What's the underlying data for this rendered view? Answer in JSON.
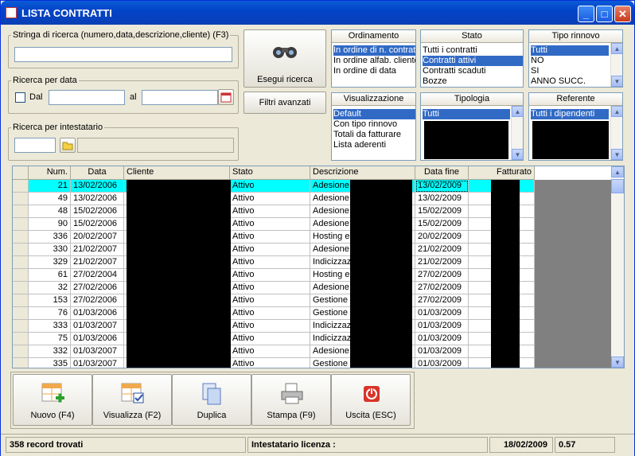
{
  "window": {
    "title": "LISTA CONTRATTI"
  },
  "search": {
    "label": "Stringa di ricerca (numero,data,descrizione,cliente) (F3)",
    "value": ""
  },
  "date_search": {
    "label": "Ricerca per data",
    "dal": "Dal",
    "al": "al"
  },
  "owner_search": {
    "label": "Ricerca per intestatario"
  },
  "buttons": {
    "search": "Esegui ricerca",
    "filters": "Filtri avanzati"
  },
  "ordinamento": {
    "title": "Ordinamento",
    "items": [
      "In ordine di n. contratto",
      "In ordine alfab. cliente",
      "In ordine di data"
    ],
    "selected": 0
  },
  "stato": {
    "title": "Stato",
    "items": [
      "Tutti i contratti",
      "Contratti attivi",
      "Contratti scaduti",
      "Bozze"
    ],
    "selected": 1
  },
  "tipo_rinnovo": {
    "title": "Tipo rinnovo",
    "items": [
      "Tutti",
      "NO",
      "SI",
      "ANNO SUCC."
    ],
    "selected": 0
  },
  "visualizzazione": {
    "title": "Visualizzazione",
    "items": [
      "Default",
      "Con tipo rinnovo",
      "Totali da fatturare",
      "Lista aderenti"
    ],
    "selected": 0
  },
  "tipologia": {
    "title": "Tipologia",
    "items": [
      "Tutti"
    ],
    "selected": 0
  },
  "referente": {
    "title": "Referente",
    "items": [
      "Tutti i dipendenti"
    ],
    "selected": 0
  },
  "grid": {
    "columns": [
      "Num.",
      "Data",
      "Cliente",
      "Stato",
      "Descrizione",
      "Data fine",
      "Fatturato"
    ],
    "rows": [
      {
        "num": "21",
        "data": "13/02/2006",
        "stato": "Attivo",
        "desc": "Adesione",
        "fine": "13/02/2009"
      },
      {
        "num": "49",
        "data": "13/02/2006",
        "stato": "Attivo",
        "desc": "Adesione",
        "fine": "13/02/2009"
      },
      {
        "num": "48",
        "data": "15/02/2006",
        "stato": "Attivo",
        "desc": "Adesione",
        "fine": "15/02/2009"
      },
      {
        "num": "90",
        "data": "15/02/2006",
        "stato": "Attivo",
        "desc": "Adesione",
        "fine": "15/02/2009"
      },
      {
        "num": "336",
        "data": "20/02/2007",
        "stato": "Attivo",
        "desc": "Hosting e",
        "fine": "20/02/2009"
      },
      {
        "num": "330",
        "data": "21/02/2007",
        "stato": "Attivo",
        "desc": "Adesione",
        "fine": "21/02/2009"
      },
      {
        "num": "329",
        "data": "21/02/2007",
        "stato": "Attivo",
        "desc": "Indicizzaz",
        "fine": "21/02/2009"
      },
      {
        "num": "61",
        "data": "27/02/2004",
        "stato": "Attivo",
        "desc": "Hosting e",
        "fine": "27/02/2009"
      },
      {
        "num": "32",
        "data": "27/02/2006",
        "stato": "Attivo",
        "desc": "Adesione",
        "fine": "27/02/2009"
      },
      {
        "num": "153",
        "data": "27/02/2006",
        "stato": "Attivo",
        "desc": "Gestione",
        "fine": "27/02/2009"
      },
      {
        "num": "76",
        "data": "01/03/2006",
        "stato": "Attivo",
        "desc": "Gestione",
        "fine": "01/03/2009"
      },
      {
        "num": "333",
        "data": "01/03/2007",
        "stato": "Attivo",
        "desc": "Indicizzaz",
        "fine": "01/03/2009"
      },
      {
        "num": "75",
        "data": "01/03/2006",
        "stato": "Attivo",
        "desc": "Indicizzaz",
        "fine": "01/03/2009"
      },
      {
        "num": "332",
        "data": "01/03/2007",
        "stato": "Attivo",
        "desc": "Adesione",
        "fine": "01/03/2009"
      },
      {
        "num": "335",
        "data": "01/03/2007",
        "stato": "Attivo",
        "desc": "Gestione",
        "fine": "01/03/2009"
      }
    ]
  },
  "toolbar": {
    "nuovo": "Nuovo (F4)",
    "visualizza": "Visualizza (F2)",
    "duplica": "Duplica",
    "stampa": "Stampa (F9)",
    "uscita": "Uscita (ESC)"
  },
  "status": {
    "records": "358 record trovati",
    "licenza": "Intestatario licenza :",
    "date": "18/02/2009",
    "version": "0.57"
  },
  "colors": {
    "titlebar": "#0244c8",
    "selection": "#316ac5",
    "highlight_row": "#00ffff"
  }
}
